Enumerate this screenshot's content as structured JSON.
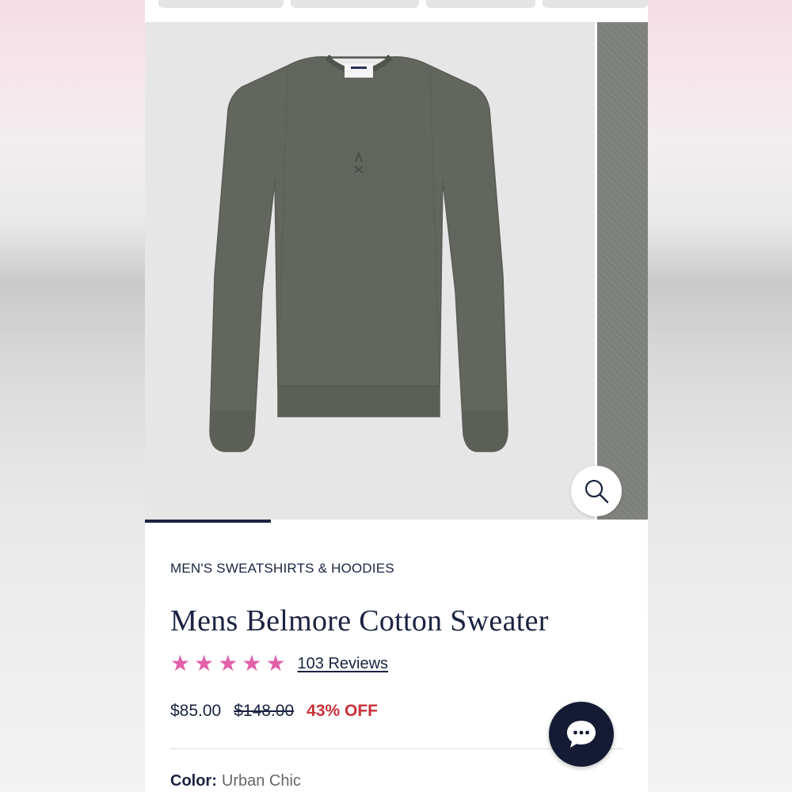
{
  "product": {
    "category": "MEN'S SWEATSHIRTS & HOODIES",
    "title": "Mens Belmore Cotton Sweater",
    "rating": 5,
    "reviews_label": "103 Reviews",
    "price_current": "$85.00",
    "price_original": "$148.00",
    "discount": "43% OFF",
    "color_label": "Color:",
    "color_value": "Urban Chic"
  },
  "gallery": {
    "thumbnail_count": 4,
    "slide_progress": 0.25,
    "zoom_icon": "search-icon"
  },
  "chat": {
    "icon": "chat-bubble-icon"
  },
  "colors": {
    "navy": "#1b2340",
    "star_pink": "#e35fa9",
    "discount_red": "#c8323a",
    "sweater_gray": "#62665f",
    "chat_bg": "#141b33"
  }
}
